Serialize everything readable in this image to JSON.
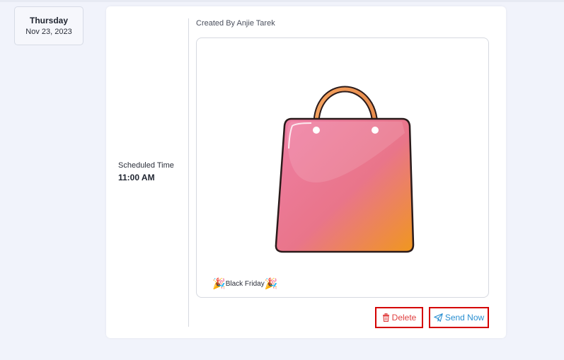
{
  "date": {
    "day": "Thursday",
    "date": "Nov 23, 2023"
  },
  "schedule": {
    "label": "Scheduled Time",
    "time": "11:00 AM"
  },
  "post": {
    "created_by": "Created By Anjie Tarek",
    "caption": "Black Friday",
    "image": "pink-shopping-bag-illustration"
  },
  "actions": {
    "delete_label": "Delete",
    "send_label": "Send Now"
  },
  "colors": {
    "delete": "#e04040",
    "send": "#2a8fd1",
    "highlight_border": "#d40000"
  }
}
